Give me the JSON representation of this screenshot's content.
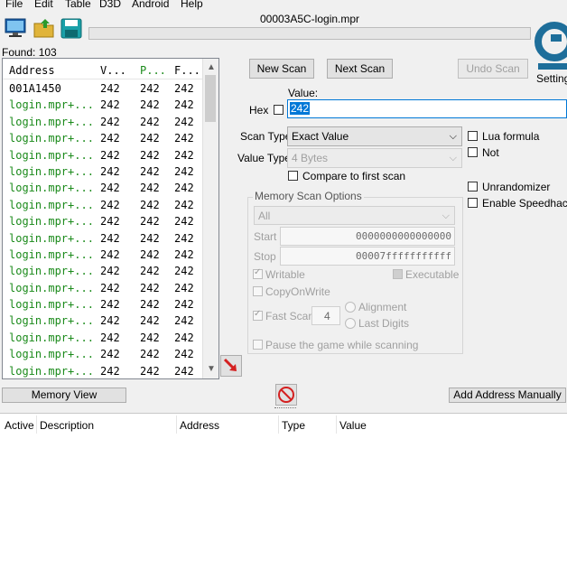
{
  "menu": [
    "File",
    "Edit",
    "Table",
    "D3D",
    "Android",
    "Help"
  ],
  "window_title": "00003A5C-login.mpr",
  "found_label": "Found: 103",
  "results": {
    "columns": [
      "Address",
      "V...",
      "P...",
      "F..."
    ],
    "rows": [
      {
        "address": "001A1450",
        "value": "242",
        "previous": "242",
        "first": "242"
      },
      {
        "address": "login.mpr+...",
        "value": "242",
        "previous": "242",
        "first": "242"
      },
      {
        "address": "login.mpr+...",
        "value": "242",
        "previous": "242",
        "first": "242"
      },
      {
        "address": "login.mpr+...",
        "value": "242",
        "previous": "242",
        "first": "242"
      },
      {
        "address": "login.mpr+...",
        "value": "242",
        "previous": "242",
        "first": "242"
      },
      {
        "address": "login.mpr+...",
        "value": "242",
        "previous": "242",
        "first": "242"
      },
      {
        "address": "login.mpr+...",
        "value": "242",
        "previous": "242",
        "first": "242"
      },
      {
        "address": "login.mpr+...",
        "value": "242",
        "previous": "242",
        "first": "242"
      },
      {
        "address": "login.mpr+...",
        "value": "242",
        "previous": "242",
        "first": "242"
      },
      {
        "address": "login.mpr+...",
        "value": "242",
        "previous": "242",
        "first": "242"
      },
      {
        "address": "login.mpr+...",
        "value": "242",
        "previous": "242",
        "first": "242"
      },
      {
        "address": "login.mpr+...",
        "value": "242",
        "previous": "242",
        "first": "242"
      },
      {
        "address": "login.mpr+...",
        "value": "242",
        "previous": "242",
        "first": "242"
      },
      {
        "address": "login.mpr+...",
        "value": "242",
        "previous": "242",
        "first": "242"
      },
      {
        "address": "login.mpr+...",
        "value": "242",
        "previous": "242",
        "first": "242"
      },
      {
        "address": "login.mpr+...",
        "value": "242",
        "previous": "242",
        "first": "242"
      },
      {
        "address": "login.mpr+...",
        "value": "242",
        "previous": "242",
        "first": "242"
      },
      {
        "address": "login.mpr+...",
        "value": "242",
        "previous": "242",
        "first": "242"
      },
      {
        "address": "login.mpr+...",
        "value": "242",
        "previous": "242",
        "first": "242"
      },
      {
        "address": "login.mpr+...",
        "value": "242",
        "previous": "242",
        "first": "242"
      }
    ]
  },
  "scan": {
    "new_scan": "New Scan",
    "next_scan": "Next Scan",
    "undo_scan": "Undo Scan",
    "settings": "Settings",
    "value_label": "Value:",
    "hex_label": "Hex",
    "value": "242",
    "scan_type_label": "Scan Type",
    "scan_type": "Exact Value",
    "value_type_label": "Value Type",
    "value_type": "4 Bytes",
    "compare_first": "Compare to first scan",
    "lua_formula": "Lua formula",
    "not_label": "Not",
    "unrandomizer": "Unrandomizer",
    "speedhack": "Enable Speedhack"
  },
  "memory_options": {
    "title": "Memory Scan Options",
    "region": "All",
    "start_label": "Start",
    "start": "0000000000000000",
    "stop_label": "Stop",
    "stop": "00007fffffffffff",
    "writable": "Writable",
    "executable": "Executable",
    "copy_on_write": "CopyOnWrite",
    "fast_scan": "Fast Scan",
    "fast_scan_value": "4",
    "alignment": "Alignment",
    "last_digits": "Last Digits",
    "pause_game": "Pause the game while scanning"
  },
  "memory_view": "Memory View",
  "add_address": "Add Address Manually",
  "address_list": {
    "columns": [
      "Active",
      "Description",
      "Address",
      "Type",
      "Value"
    ]
  },
  "colors": {
    "accent_blue": "#0078d7",
    "green_text": "#1a8a1a",
    "logo": "#1e6e9a"
  }
}
